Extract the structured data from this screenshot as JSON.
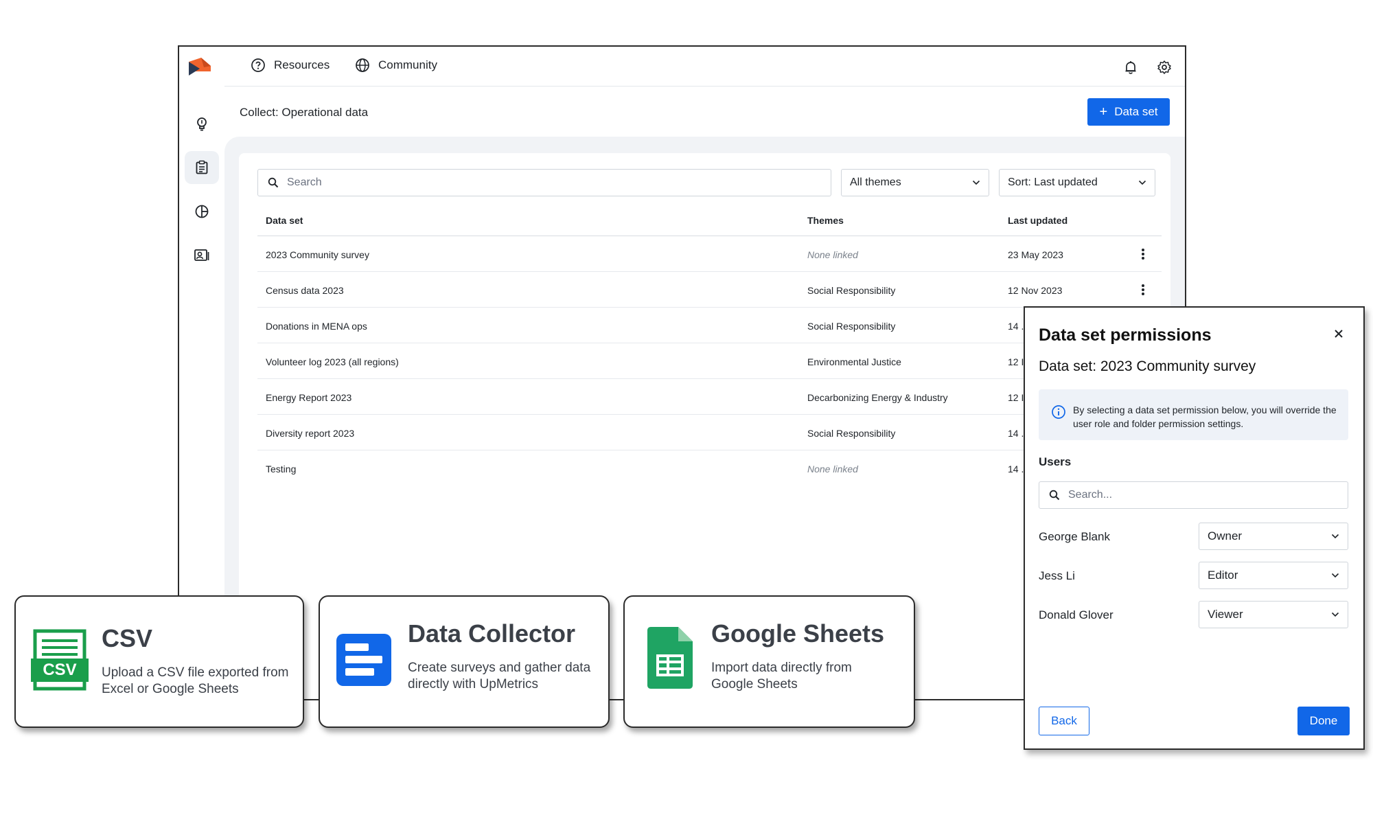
{
  "topbar": {
    "nav": [
      {
        "label": "Resources",
        "icon": "help-circle-icon"
      },
      {
        "label": "Community",
        "icon": "globe-icon"
      }
    ],
    "icons": [
      "bell-icon",
      "gear-icon",
      "avatar"
    ]
  },
  "sidebar": {
    "items": [
      {
        "icon": "lightbulb-icon",
        "active": false
      },
      {
        "icon": "clipboard-icon",
        "active": true
      },
      {
        "icon": "pie-chart-icon",
        "active": false
      },
      {
        "icon": "contact-card-icon",
        "active": false
      }
    ]
  },
  "page": {
    "title": "Collect: Operational data",
    "add_button": "Data set"
  },
  "filters": {
    "search_placeholder": "Search",
    "themes": "All themes",
    "sort": "Sort: Last updated"
  },
  "table": {
    "headers": [
      "Data set",
      "Themes",
      "Last updated"
    ],
    "rows": [
      {
        "name": "2023 Community survey",
        "theme": "None linked",
        "updated": "23 May 2023",
        "muted": true
      },
      {
        "name": "Census data 2023",
        "theme": "Social Responsibility",
        "updated": "12 Nov 2023",
        "muted": false
      },
      {
        "name": "Donations in MENA ops",
        "theme": "Social Responsibility",
        "updated": "14 .",
        "muted": false
      },
      {
        "name": "Volunteer log 2023 (all regions)",
        "theme": "Environmental Justice",
        "updated": "12 I",
        "muted": false
      },
      {
        "name": "Energy Report 2023",
        "theme": "Decarbonizing Energy & Industry",
        "updated": "12 I",
        "muted": false
      },
      {
        "name": "Diversity report 2023",
        "theme": "Social Responsibility",
        "updated": "14 .",
        "muted": false
      },
      {
        "name": "Testing",
        "theme": "None linked",
        "updated": "14 .",
        "muted": true
      }
    ]
  },
  "cards": [
    {
      "title": "CSV",
      "description": "Upload a CSV file exported from Excel or Google Sheets",
      "icon": "csv-file-icon",
      "icon_label": "CSV",
      "color": "#1a9e4b"
    },
    {
      "title": "Data Collector",
      "description": "Create surveys and gather data directly with UpMetrics",
      "icon": "data-collector-icon",
      "color": "#1167e8"
    },
    {
      "title": "Google Sheets",
      "description": "Import data directly from Google Sheets",
      "icon": "google-sheets-icon",
      "color": "#1fa463"
    }
  ],
  "dialog": {
    "title": "Data set permissions",
    "subtitle": "Data set: 2023 Community survey",
    "info": "By selecting a data set permission below, you will override the user role and folder permission settings.",
    "users_label": "Users",
    "search_placeholder": "Search...",
    "users": [
      {
        "name": "George Blank",
        "role": "Owner"
      },
      {
        "name": "Jess Li",
        "role": "Editor"
      },
      {
        "name": "Donald Glover",
        "role": "Viewer"
      }
    ],
    "back": "Back",
    "done": "Done"
  },
  "colors": {
    "accent": "#1167e8",
    "logo": "#f0642d"
  }
}
